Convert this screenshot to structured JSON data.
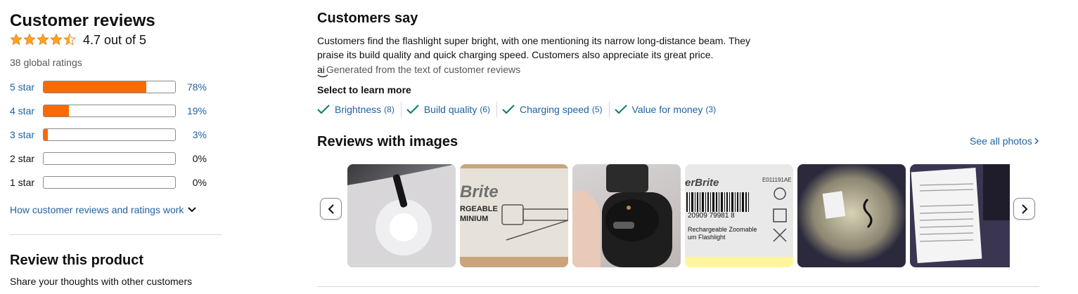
{
  "left": {
    "title": "Customer reviews",
    "rating_value": 4.7,
    "rating_text": "4.7 out of 5",
    "global_ratings": "38 global ratings",
    "histogram": [
      {
        "label": "5 star",
        "percent": 78,
        "percent_text": "78%",
        "link": true
      },
      {
        "label": "4 star",
        "percent": 19,
        "percent_text": "19%",
        "link": true
      },
      {
        "label": "3 star",
        "percent": 3,
        "percent_text": "3%",
        "link": true
      },
      {
        "label": "2 star",
        "percent": 0,
        "percent_text": "0%",
        "link": false
      },
      {
        "label": "1 star",
        "percent": 0,
        "percent_text": "0%",
        "link": false
      }
    ],
    "how_link": "How customer reviews and ratings work",
    "review_title": "Review this product",
    "review_sub": "Share your thoughts with other customers"
  },
  "right": {
    "customers_say_title": "Customers say",
    "summary_line1": "Customers find the flashlight super bright, with one mentioning its narrow long-distance beam. They",
    "summary_line2": "praise its build quality and quick charging speed. Customers also appreciate its great price.",
    "ai_icon_text": "ai",
    "generated_text": "Generated from the text of customer reviews",
    "select_title": "Select to learn more",
    "aspects": [
      {
        "label": "Brightness",
        "count": "(8)"
      },
      {
        "label": "Build quality",
        "count": "(6)"
      },
      {
        "label": "Charging speed",
        "count": "(5)"
      },
      {
        "label": "Value for money",
        "count": "(3)"
      }
    ],
    "images_title": "Reviews with images",
    "see_all": "See all photos",
    "thumb_texts": {
      "t2_brand": "Brite",
      "t2_line1": "RGEABLE",
      "t2_line2": "MINIUM",
      "t4_brand": "erBrite",
      "t4_code": "E011191AE",
      "t4_barcode": "20909  79981  8",
      "t4_line1": "Rechargeable Zoomable",
      "t4_line2": "um Flashlight"
    }
  },
  "colors": {
    "star": "#FFA41C",
    "bar_fill": "#FF6A00",
    "link": "#2162A1",
    "check": "#067D62"
  }
}
